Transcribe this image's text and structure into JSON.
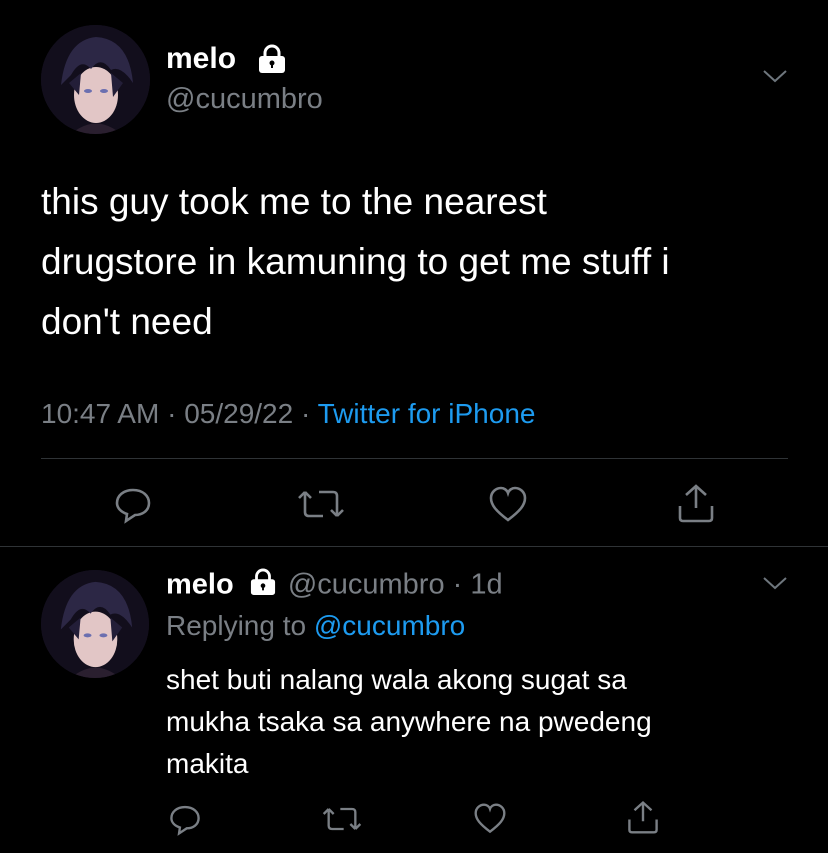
{
  "main_tweet": {
    "author_name": "melo",
    "author_handle": "@cucumbro",
    "text_lines": [
      "this guy took me to the nearest",
      "drugstore in kamuning to get me stuff i",
      "don't need"
    ],
    "time": "10:47 AM",
    "sep1": "·",
    "date": "05/29/22",
    "sep2": "·",
    "source": "Twitter for iPhone"
  },
  "reply_tweet": {
    "author_name": "melo",
    "author_handle": "@cucumbro",
    "sep": "·",
    "age": "1d",
    "replying_prefix": "Replying to",
    "replying_handle": "@cucumbro",
    "text_lines": [
      "shet buti nalang wala akong sugat sa",
      "mukha tsaka sa anywhere na pwedeng",
      "makita"
    ]
  },
  "icons": {
    "lock": "lock-icon",
    "chevron": "chevron-down-icon",
    "reply": "reply-icon",
    "retweet": "retweet-icon",
    "like": "heart-icon",
    "share": "share-icon"
  },
  "colors": {
    "background": "#000000",
    "text": "#ffffff",
    "secondary": "#7a7f85",
    "accent": "#1d9bf0",
    "divider": "#2f3336"
  }
}
